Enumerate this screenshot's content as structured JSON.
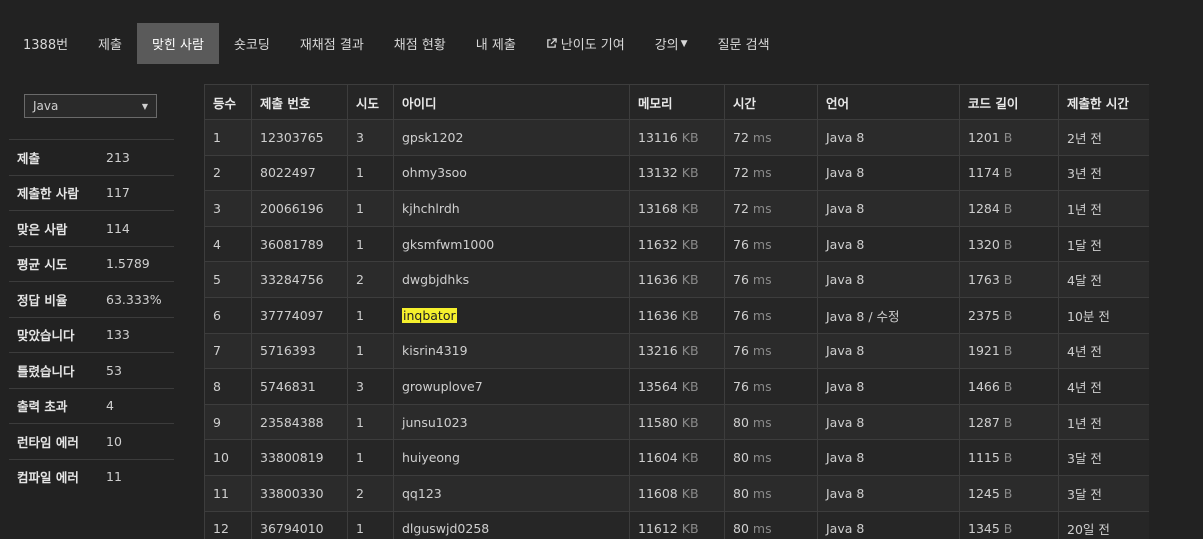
{
  "nav": {
    "tabs": [
      {
        "label": "1388번"
      },
      {
        "label": "제출"
      },
      {
        "label": "맞힌 사람"
      },
      {
        "label": "숏코딩"
      },
      {
        "label": "재채점 결과"
      },
      {
        "label": "채점 현황"
      },
      {
        "label": "내 제출"
      },
      {
        "label": "난이도 기여"
      },
      {
        "label": "강의"
      },
      {
        "label": "질문 검색"
      }
    ],
    "active_index": 2
  },
  "sidebar": {
    "language_select": "Java",
    "stats": [
      {
        "label": "제출",
        "value": "213"
      },
      {
        "label": "제출한 사람",
        "value": "117"
      },
      {
        "label": "맞은 사람",
        "value": "114"
      },
      {
        "label": "평균 시도",
        "value": "1.5789"
      },
      {
        "label": "정답 비율",
        "value": "63.333%"
      },
      {
        "label": "맞았습니다",
        "value": "133"
      },
      {
        "label": "틀렸습니다",
        "value": "53"
      },
      {
        "label": "출력 초과",
        "value": "4"
      },
      {
        "label": "런타임 에러",
        "value": "10"
      },
      {
        "label": "컴파일 에러",
        "value": "11"
      }
    ]
  },
  "table": {
    "headers": [
      "등수",
      "제출 번호",
      "시도",
      "아이디",
      "메모리",
      "시간",
      "언어",
      "코드 길이",
      "제출한 시간"
    ],
    "units": {
      "memory": "KB",
      "time": "ms",
      "code": "B"
    },
    "edit_label": "수정",
    "rows": [
      {
        "rank": "1",
        "submission": "12303765",
        "tries": "3",
        "user": "gpsk1202",
        "memory": "13116",
        "time": "72",
        "lang": "Java 8",
        "code": "1201",
        "when": "2년 전"
      },
      {
        "rank": "2",
        "submission": "8022497",
        "tries": "1",
        "user": "ohmy3soo",
        "memory": "13132",
        "time": "72",
        "lang": "Java 8",
        "code": "1174",
        "when": "3년 전"
      },
      {
        "rank": "3",
        "submission": "20066196",
        "tries": "1",
        "user": "kjhchlrdh",
        "memory": "13168",
        "time": "72",
        "lang": "Java 8",
        "code": "1284",
        "when": "1년 전"
      },
      {
        "rank": "4",
        "submission": "36081789",
        "tries": "1",
        "user": "gksmfwm1000",
        "memory": "11632",
        "time": "76",
        "lang": "Java 8",
        "code": "1320",
        "when": "1달 전"
      },
      {
        "rank": "5",
        "submission": "33284756",
        "tries": "2",
        "user": "dwgbjdhks",
        "memory": "11636",
        "time": "76",
        "lang": "Java 8",
        "code": "1763",
        "when": "4달 전"
      },
      {
        "rank": "6",
        "submission": "37774097",
        "tries": "1",
        "user": "inqbator",
        "memory": "11636",
        "time": "76",
        "lang": "Java 8",
        "code": "2375",
        "when": "10분 전",
        "highlight": true,
        "editable": true
      },
      {
        "rank": "7",
        "submission": "5716393",
        "tries": "1",
        "user": "kisrin4319",
        "memory": "13216",
        "time": "76",
        "lang": "Java 8",
        "code": "1921",
        "when": "4년 전"
      },
      {
        "rank": "8",
        "submission": "5746831",
        "tries": "3",
        "user": "growuplove7",
        "memory": "13564",
        "time": "76",
        "lang": "Java 8",
        "code": "1466",
        "when": "4년 전"
      },
      {
        "rank": "9",
        "submission": "23584388",
        "tries": "1",
        "user": "junsu1023",
        "memory": "11580",
        "time": "80",
        "lang": "Java 8",
        "code": "1287",
        "when": "1년 전"
      },
      {
        "rank": "10",
        "submission": "33800819",
        "tries": "1",
        "user": "huiyeong",
        "memory": "11604",
        "time": "80",
        "lang": "Java 8",
        "code": "1115",
        "when": "3달 전"
      },
      {
        "rank": "11",
        "submission": "33800330",
        "tries": "2",
        "user": "qq123",
        "memory": "11608",
        "time": "80",
        "lang": "Java 8",
        "code": "1245",
        "when": "3달 전"
      },
      {
        "rank": "12",
        "submission": "36794010",
        "tries": "1",
        "user": "dlguswjd0258",
        "memory": "11612",
        "time": "80",
        "lang": "Java 8",
        "code": "1345",
        "when": "20일 전"
      }
    ]
  }
}
